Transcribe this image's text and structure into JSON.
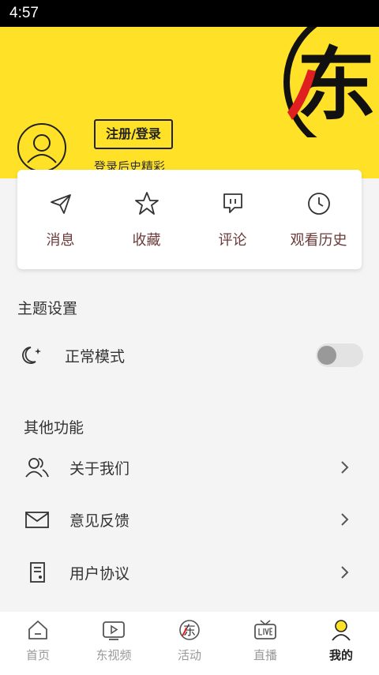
{
  "status_bar": {
    "time": "4:57"
  },
  "header": {
    "logo_char": "东",
    "login_button": "注册/登录",
    "login_subtitle": "登录后史精彩"
  },
  "quick_actions": [
    {
      "label": "消息",
      "icon": "paper-plane-icon"
    },
    {
      "label": "收藏",
      "icon": "star-icon"
    },
    {
      "label": "评论",
      "icon": "comment-icon"
    },
    {
      "label": "观看历史",
      "icon": "clock-icon"
    }
  ],
  "theme": {
    "title": "主题设置",
    "mode_label": "正常模式",
    "mode_icon": "moon-icon",
    "toggle_on": false
  },
  "other": {
    "title": "其他功能",
    "items": [
      {
        "label": "关于我们",
        "icon": "users-icon"
      },
      {
        "label": "意见反馈",
        "icon": "envelope-icon"
      },
      {
        "label": "用户协议",
        "icon": "document-icon"
      }
    ]
  },
  "bottom_nav": {
    "items": [
      {
        "label": "首页",
        "icon": "home-icon"
      },
      {
        "label": "东视频",
        "icon": "video-icon"
      },
      {
        "label": "活动",
        "icon": "dong-logo-icon"
      },
      {
        "label": "直播",
        "icon": "live-tv-icon"
      },
      {
        "label": "我的",
        "icon": "person-icon"
      }
    ],
    "active_index": 4
  },
  "colors": {
    "brand_yellow": "#ffe227",
    "accent_red": "#e02020",
    "label_brown": "#6b3a3a"
  }
}
